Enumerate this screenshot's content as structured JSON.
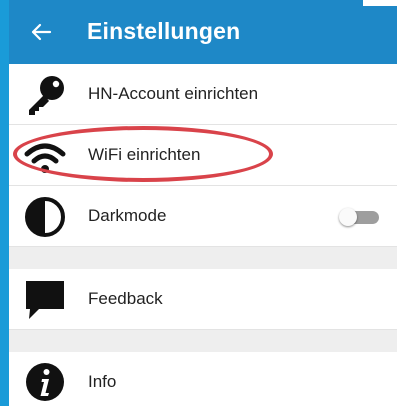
{
  "header": {
    "title": "Einstellungen",
    "back_icon": "arrow-left-icon"
  },
  "colors": {
    "appbar": "#1e88c7",
    "background": "#1a9bd8",
    "highlight": "#d9434a",
    "toggle_off": "#9e9e9e"
  },
  "settings": {
    "items": [
      {
        "label": "HN-Account einrichten",
        "icon": "key-icon"
      },
      {
        "label": "WiFi einrichten",
        "icon": "wifi-icon"
      },
      {
        "label": "Darkmode",
        "icon": "contrast-icon",
        "toggle": false
      },
      {
        "label": "Feedback",
        "icon": "speech-bubble-icon"
      },
      {
        "label": "Info",
        "icon": "info-icon"
      }
    ]
  }
}
